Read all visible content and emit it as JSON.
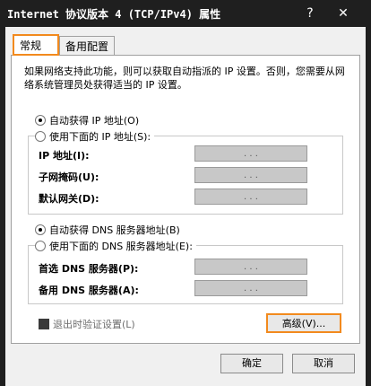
{
  "window": {
    "title": "Internet 协议版本 4 (TCP/IPv4) 属性",
    "help_glyph": "?",
    "close_glyph": "✕"
  },
  "tabs": [
    {
      "label": "常规",
      "active": true
    },
    {
      "label": "备用配置",
      "active": false
    }
  ],
  "description": "如果网络支持此功能，则可以获取自动指派的 IP 设置。否则，您需要从网络系统管理员处获得适当的 IP 设置。",
  "ip": {
    "auto_label": "自动获得 IP 地址(O)",
    "manual_label": "使用下面的 IP 地址(S):",
    "fields": [
      {
        "label": "IP 地址(I):",
        "value": ". . ."
      },
      {
        "label": "子网掩码(U):",
        "value": ". . ."
      },
      {
        "label": "默认网关(D):",
        "value": ". . ."
      }
    ]
  },
  "dns": {
    "auto_label": "自动获得 DNS 服务器地址(B)",
    "manual_label": "使用下面的 DNS 服务器地址(E):",
    "fields": [
      {
        "label": "首选 DNS 服务器(P):",
        "value": ". . ."
      },
      {
        "label": "备用 DNS 服务器(A):",
        "value": ". . ."
      }
    ]
  },
  "validate_label": "退出时验证设置(L)",
  "buttons": {
    "advanced": "高级(V)...",
    "ok": "确定",
    "cancel": "取消"
  },
  "colors": {
    "highlight": "#f28a1e",
    "titlebar": "#1f1f1f",
    "field_disabled": "#c8c8c8"
  }
}
